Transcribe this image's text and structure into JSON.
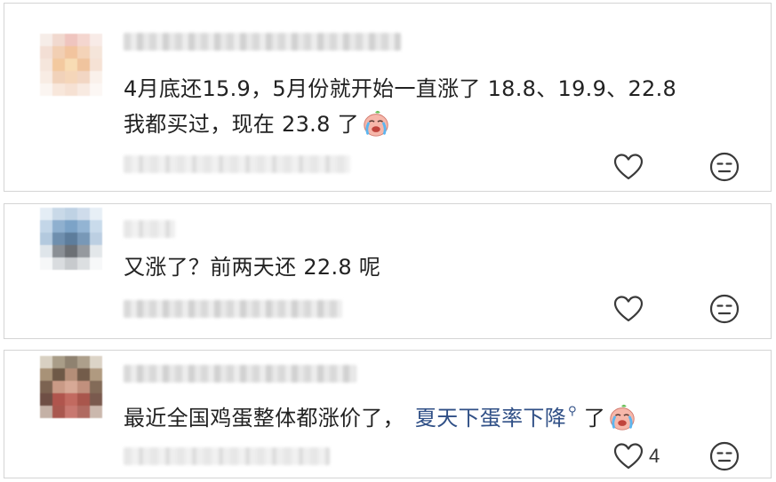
{
  "comments": [
    {
      "text": "4月底还15.9，5月份就开始一直涨了 18.8、19.9、22.8",
      "text_line2": "我都买过，现在 23.8 了",
      "emoji": "crying-face-emoji",
      "like_count": ""
    },
    {
      "text": "又涨了？前两天还 22.8 呢",
      "like_count": ""
    },
    {
      "text": "最近全国鸡蛋整体都涨价了，",
      "link_text": "夏天下蛋率下降",
      "search_glyph": "⚲",
      "text_after": "了",
      "emoji": "crying-face-emoji",
      "like_count": "4"
    }
  ],
  "icons": {
    "like": "heart-outline-icon",
    "dislike": "neutral-face-icon"
  },
  "colors": {
    "text": "#222222",
    "link": "#2f4f86",
    "border": "#d4d4d4",
    "icon": "#3a3a3a"
  }
}
